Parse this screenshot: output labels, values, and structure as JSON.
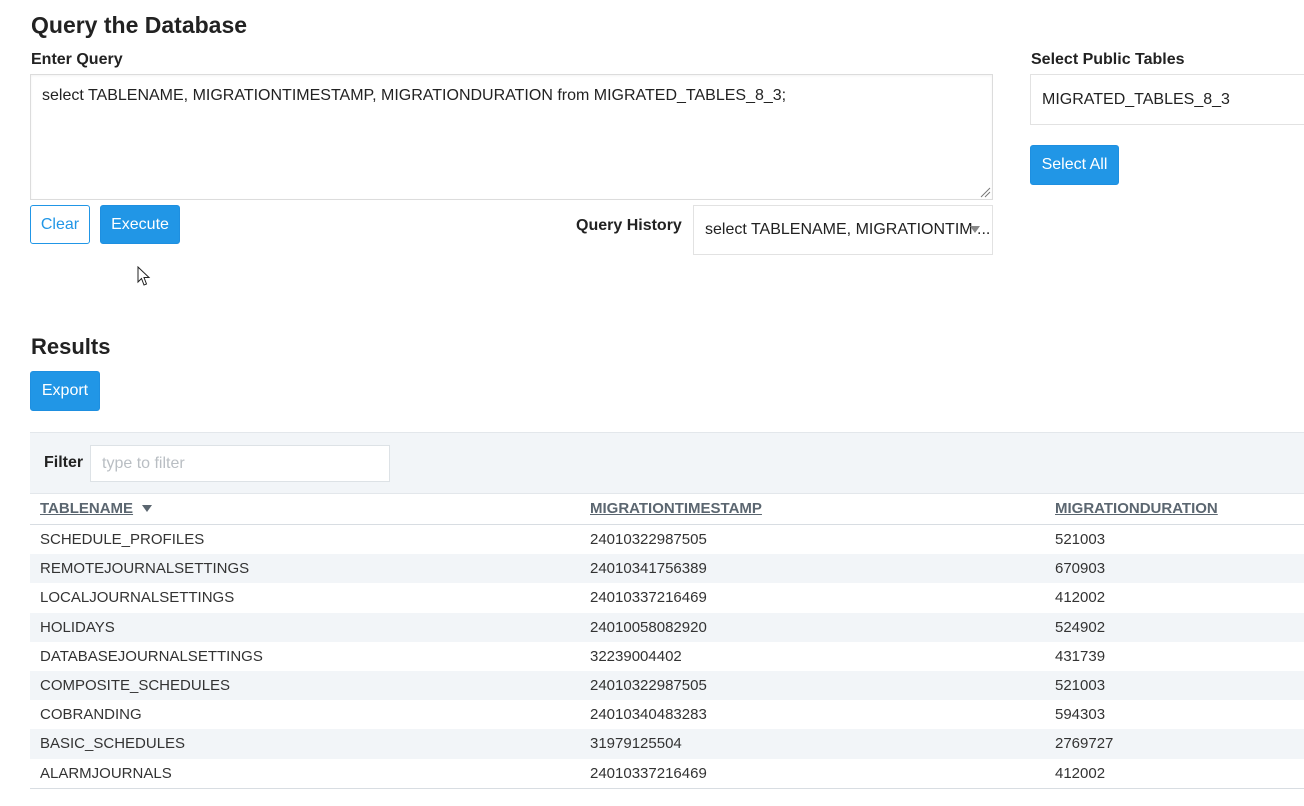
{
  "page_title": "Query the Database",
  "query": {
    "label": "Enter Query",
    "text": "select TABLENAME, MIGRATIONTIMESTAMP, MIGRATIONDURATION from MIGRATED_TABLES_8_3;",
    "clear_label": "Clear",
    "execute_label": "Execute",
    "history_label": "Query History",
    "history_selected": "select TABLENAME, MIGRATIONTIM ..."
  },
  "public_tables": {
    "label": "Select Public Tables",
    "selected": "MIGRATED_TABLES_8_3",
    "select_all_label": "Select All"
  },
  "results": {
    "title": "Results",
    "export_label": "Export",
    "filter_label": "Filter",
    "filter_placeholder": "type to filter",
    "columns": [
      "TABLENAME",
      "MIGRATIONTIMESTAMP",
      "MIGRATIONDURATION"
    ],
    "rows": [
      [
        "SCHEDULE_PROFILES",
        "24010322987505",
        "521003"
      ],
      [
        "REMOTEJOURNALSETTINGS",
        "24010341756389",
        "670903"
      ],
      [
        "LOCALJOURNALSETTINGS",
        "24010337216469",
        "412002"
      ],
      [
        "HOLIDAYS",
        "24010058082920",
        "524902"
      ],
      [
        "DATABASEJOURNALSETTINGS",
        "32239004402",
        "431739"
      ],
      [
        "COMPOSITE_SCHEDULES",
        "24010322987505",
        "521003"
      ],
      [
        "COBRANDING",
        "24010340483283",
        "594303"
      ],
      [
        "BASIC_SCHEDULES",
        "31979125504",
        "2769727"
      ],
      [
        "ALARMJOURNALS",
        "24010337216469",
        "412002"
      ]
    ]
  },
  "colors": {
    "accent": "#2196e6",
    "stripe": "#f2f5f8",
    "header_text": "#5b6670"
  },
  "icons": {
    "sort": "caret-down-icon",
    "dropdown": "chevron-down-icon",
    "cursor": "mouse-pointer-icon",
    "resize": "resize-grip-icon"
  }
}
